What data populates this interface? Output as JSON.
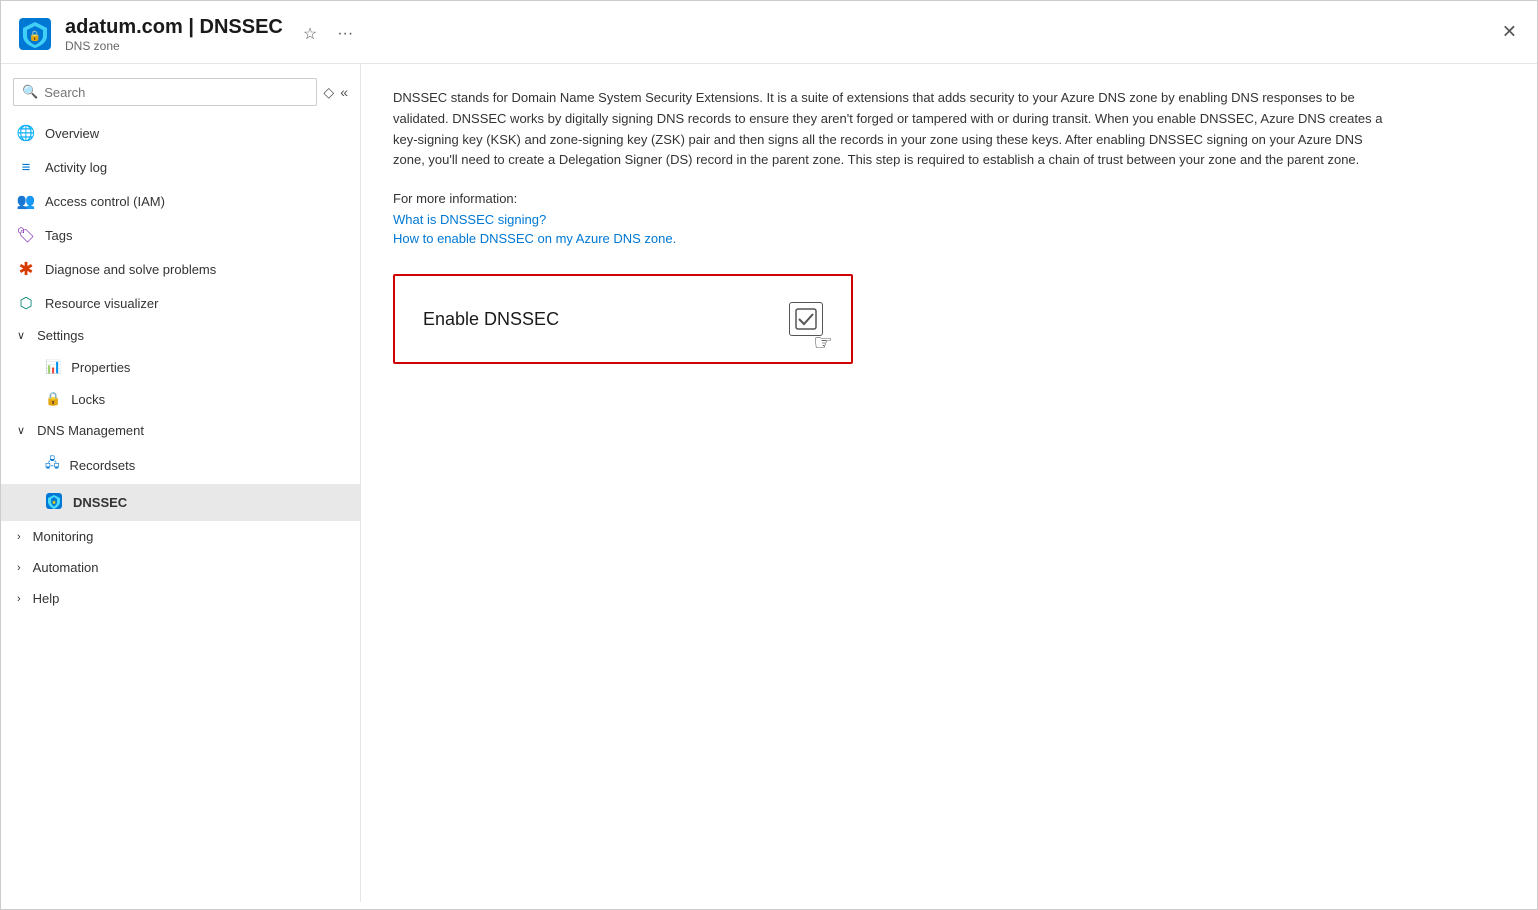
{
  "header": {
    "title": "adatum.com | DNSSEC",
    "subtitle": "DNS zone",
    "favorite_label": "☆",
    "more_label": "···",
    "close_label": "✕"
  },
  "sidebar": {
    "search_placeholder": "Search",
    "items": [
      {
        "id": "overview",
        "label": "Overview",
        "icon": "🌐",
        "level": 0,
        "active": false
      },
      {
        "id": "activity-log",
        "label": "Activity log",
        "icon": "📋",
        "level": 0,
        "active": false
      },
      {
        "id": "access-control",
        "label": "Access control (IAM)",
        "icon": "👥",
        "level": 0,
        "active": false
      },
      {
        "id": "tags",
        "label": "Tags",
        "icon": "🏷",
        "level": 0,
        "active": false
      },
      {
        "id": "diagnose",
        "label": "Diagnose and solve problems",
        "icon": "✱",
        "level": 0,
        "active": false
      },
      {
        "id": "resource-viz",
        "label": "Resource visualizer",
        "icon": "⬡",
        "level": 0,
        "active": false
      }
    ],
    "sections": [
      {
        "id": "settings",
        "label": "Settings",
        "expanded": true,
        "sub_items": [
          {
            "id": "properties",
            "label": "Properties",
            "icon": "📊",
            "active": false
          },
          {
            "id": "locks",
            "label": "Locks",
            "icon": "🔒",
            "active": false
          }
        ]
      },
      {
        "id": "dns-management",
        "label": "DNS Management",
        "expanded": true,
        "sub_items": [
          {
            "id": "recordsets",
            "label": "Recordsets",
            "icon": "🖧",
            "active": false
          },
          {
            "id": "dnssec",
            "label": "DNSSEC",
            "icon": "🛡",
            "active": true
          }
        ]
      },
      {
        "id": "monitoring",
        "label": "Monitoring",
        "expanded": false,
        "sub_items": []
      },
      {
        "id": "automation",
        "label": "Automation",
        "expanded": false,
        "sub_items": []
      },
      {
        "id": "help",
        "label": "Help",
        "expanded": false,
        "sub_items": []
      }
    ]
  },
  "main": {
    "description": "DNSSEC stands for Domain Name System Security Extensions. It is a suite of extensions that adds security to your Azure DNS zone by enabling DNS responses to be validated. DNSSEC works by digitally signing DNS records to ensure they aren't forged or tampered with or during transit. When you enable DNSSEC, Azure DNS creates a key-signing key (KSK) and zone-signing key (ZSK) pair and then signs all the records in your zone using these keys. After enabling DNSSEC signing on your Azure DNS zone, you'll need to create a Delegation Signer (DS) record in the parent zone. This step is required to establish a chain of trust between your zone and the parent zone.",
    "more_info_label": "For more information:",
    "links": [
      {
        "id": "link-what",
        "text": "What is DNSSEC signing?"
      },
      {
        "id": "link-how",
        "text": "How to enable DNSSEC on my Azure DNS zone."
      }
    ],
    "enable_card": {
      "label": "Enable DNSSEC",
      "toggle_check": "✓"
    }
  }
}
